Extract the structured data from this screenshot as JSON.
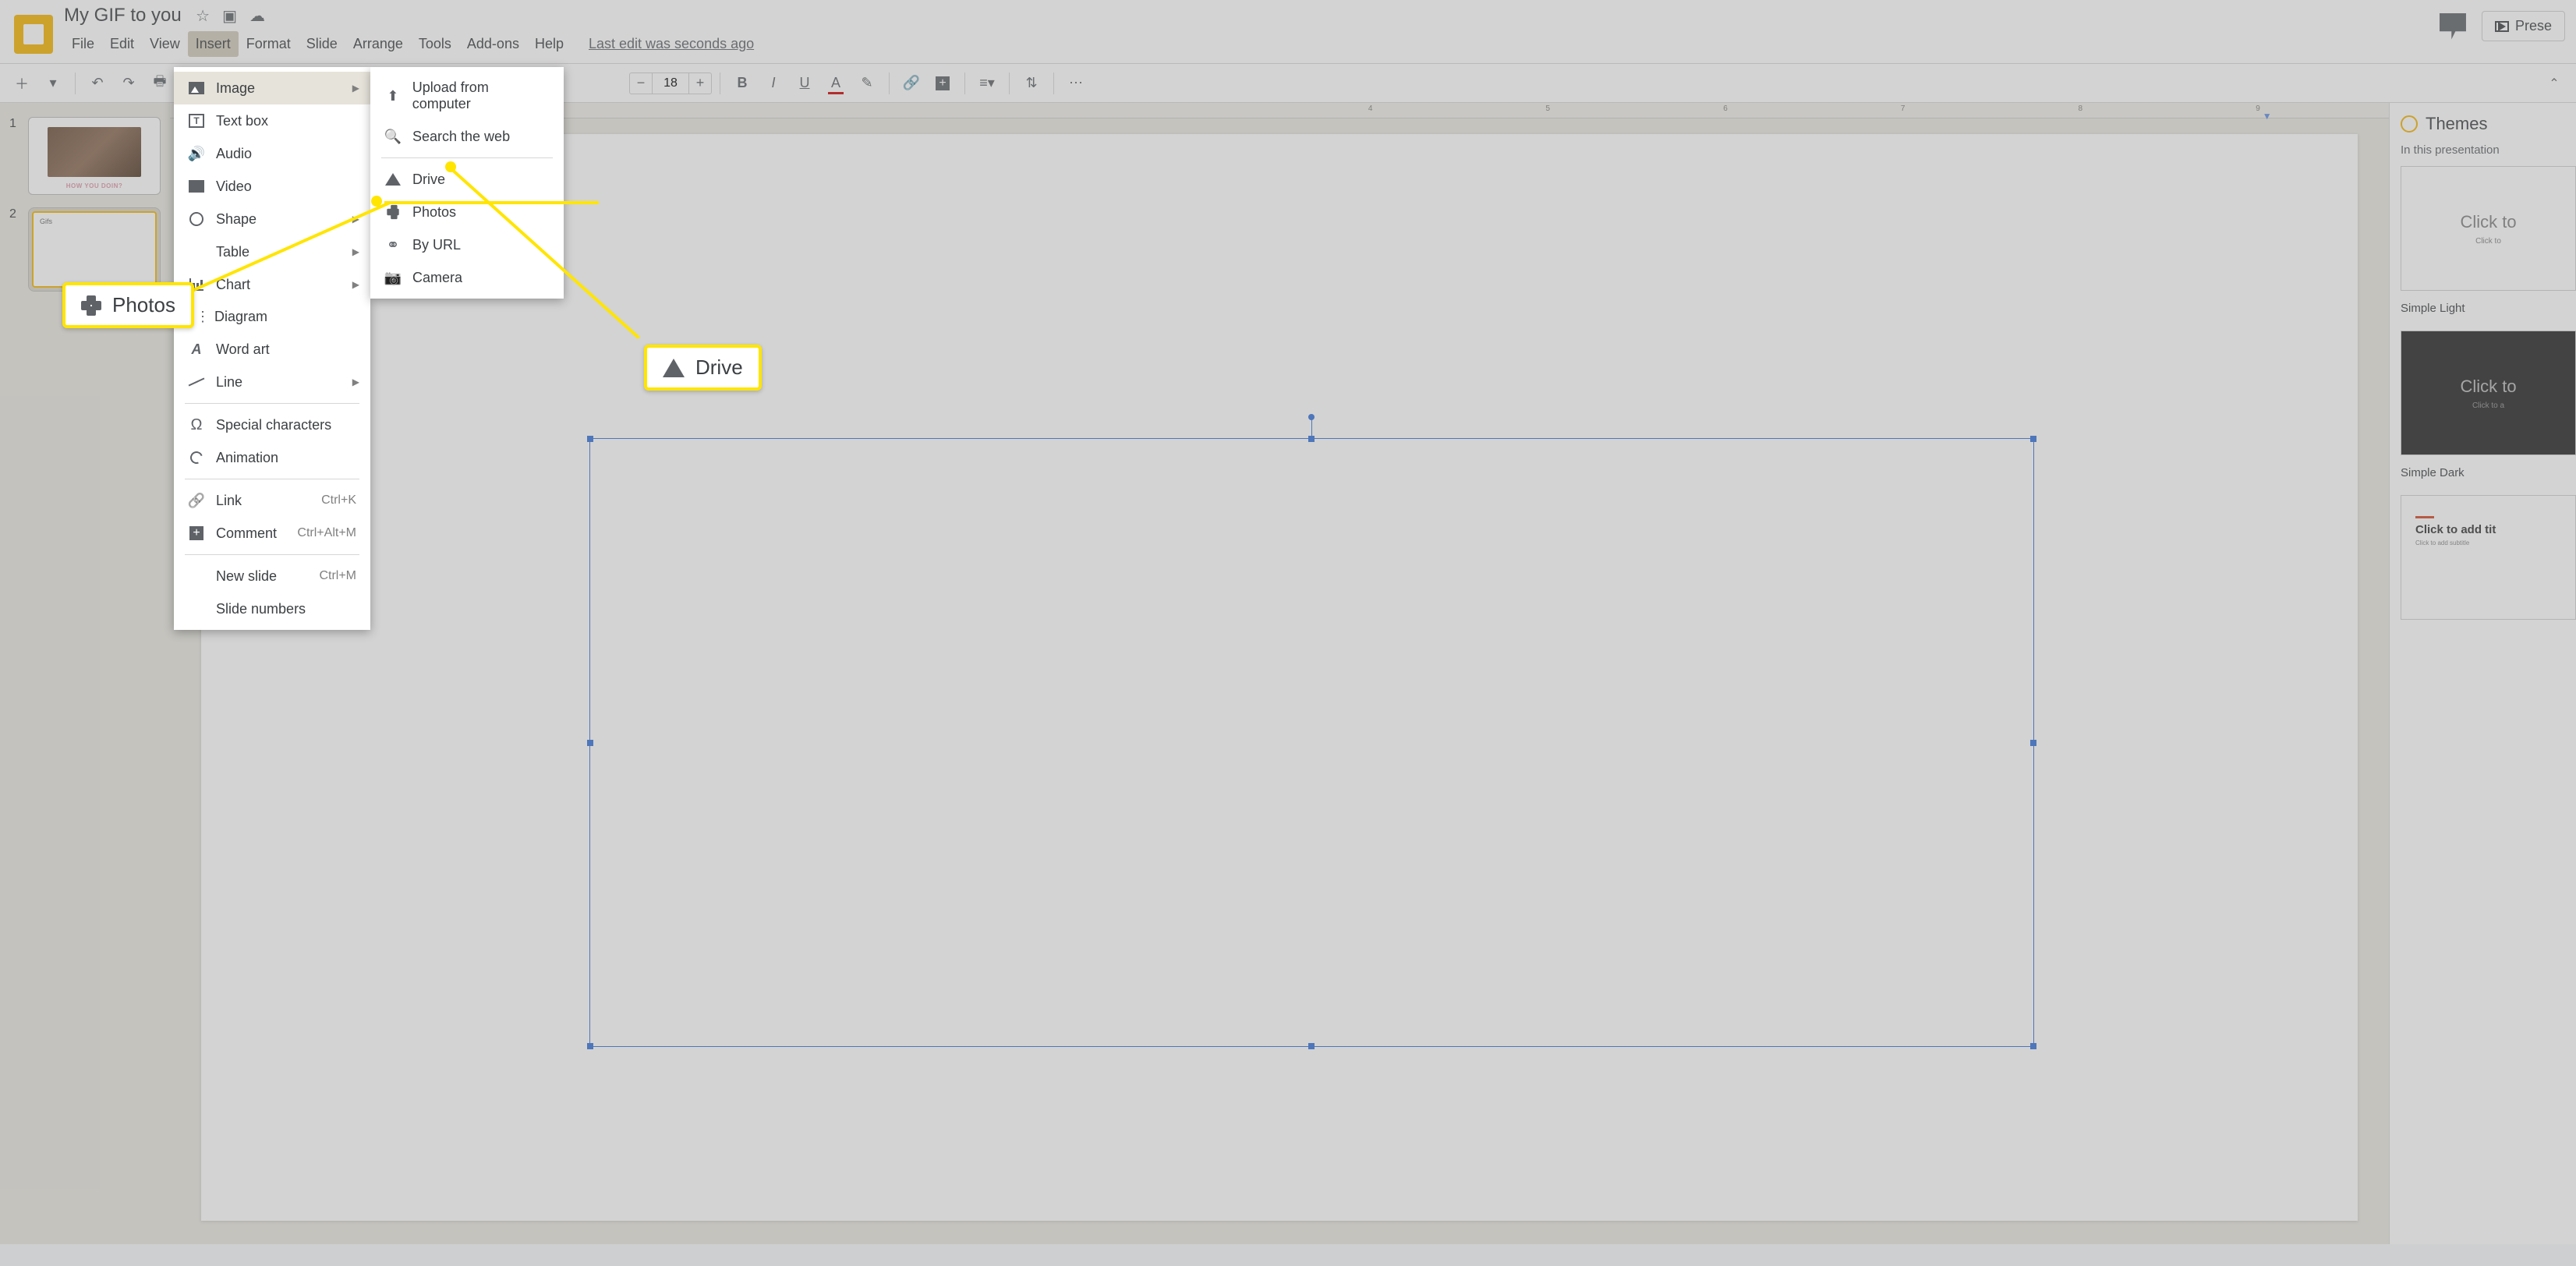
{
  "doc": {
    "title": "My GIF to you",
    "last_edit": "Last edit was seconds ago"
  },
  "menus": {
    "file": "File",
    "edit": "Edit",
    "view": "View",
    "insert": "Insert",
    "format": "Format",
    "slide": "Slide",
    "arrange": "Arrange",
    "tools": "Tools",
    "addons": "Add-ons",
    "help": "Help"
  },
  "toolbar": {
    "font_size": "18"
  },
  "present_btn": "Prese",
  "insert_menu": {
    "image": "Image",
    "textbox": "Text box",
    "audio": "Audio",
    "video": "Video",
    "shape": "Shape",
    "table": "Table",
    "chart": "Chart",
    "diagram": "Diagram",
    "wordart": "Word art",
    "line": "Line",
    "special": "Special characters",
    "animation": "Animation",
    "link": "Link",
    "link_sc": "Ctrl+K",
    "comment": "Comment",
    "comment_sc": "Ctrl+Alt+M",
    "newslide": "New slide",
    "newslide_sc": "Ctrl+M",
    "slidenums": "Slide numbers"
  },
  "image_submenu": {
    "upload": "Upload from computer",
    "search": "Search the web",
    "drive": "Drive",
    "photos": "Photos",
    "byurl": "By URL",
    "camera": "Camera"
  },
  "thumbs": {
    "n1": "1",
    "n2": "2",
    "t1_caption": "HOW YOU DOIN?",
    "t2_label": "Gifs"
  },
  "ruler": {
    "m4": "4",
    "m5": "5",
    "m6": "6",
    "m7": "7",
    "m8": "8",
    "m9": "9"
  },
  "themes": {
    "title": "Themes",
    "sub": "In this presentation",
    "card_l1": "Click to",
    "card_l2": "Click to",
    "name1": "Simple Light",
    "name2": "Simple Dark",
    "t3_title": "Click to add tit",
    "t3_sub": "Click to add subtitle"
  },
  "callouts": {
    "photos": "Photos",
    "drive": "Drive"
  }
}
